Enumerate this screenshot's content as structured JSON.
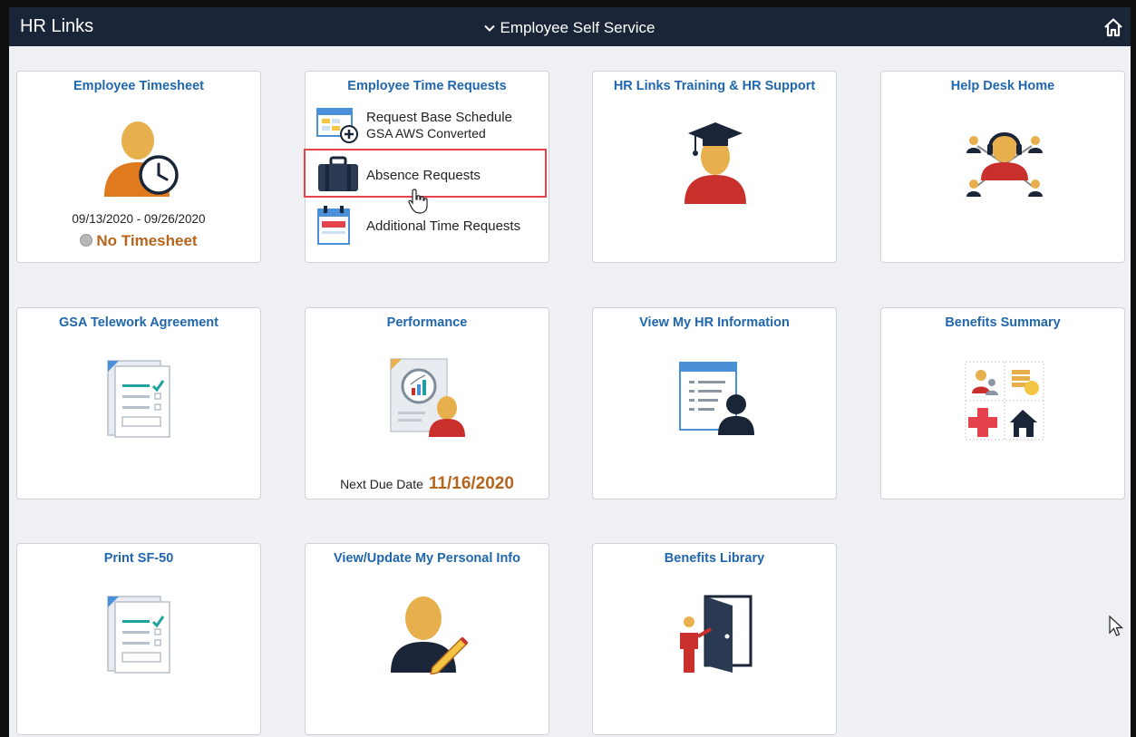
{
  "header": {
    "app_title": "HR Links",
    "nav_title": "Employee Self Service",
    "home_icon": "home-icon"
  },
  "tiles": {
    "employee_timesheet": {
      "title": "Employee Timesheet",
      "icon": "person-clock-icon",
      "date_range": "09/13/2020 - 09/26/2020",
      "status": "No Timesheet"
    },
    "employee_time_requests": {
      "title": "Employee Time Requests",
      "items": [
        {
          "label": "Request Base Schedule",
          "sublabel": "GSA AWS Converted",
          "icon": "calendar-add-icon"
        },
        {
          "label": "Absence Requests",
          "icon": "briefcase-icon"
        },
        {
          "label": "Additional Time Requests",
          "icon": "calendar-icon"
        }
      ]
    },
    "training_support": {
      "title": "HR Links Training & HR Support",
      "icon": "graduate-icon"
    },
    "help_desk": {
      "title": "Help Desk Home",
      "icon": "headset-network-icon"
    },
    "telework": {
      "title": "GSA Telework Agreement",
      "icon": "checklist-document-icon"
    },
    "performance": {
      "title": "Performance",
      "icon": "performance-report-icon",
      "due_label": "Next Due Date",
      "due_value": "11/16/2020"
    },
    "hr_information": {
      "title": "View My HR Information",
      "icon": "profile-document-icon"
    },
    "benefits_summary": {
      "title": "Benefits Summary",
      "icon": "benefits-grid-icon"
    },
    "print_sf50": {
      "title": "Print SF-50",
      "icon": "checklist-document-icon"
    },
    "personal_info": {
      "title": "View/Update My Personal Info",
      "icon": "person-edit-icon"
    },
    "benefits_library": {
      "title": "Benefits Library",
      "icon": "door-presenter-icon"
    }
  },
  "colors": {
    "header_bg": "#1a2638",
    "tile_title": "#2067ad",
    "accent_orange": "#b5651d",
    "highlight_red": "#e5434b"
  }
}
